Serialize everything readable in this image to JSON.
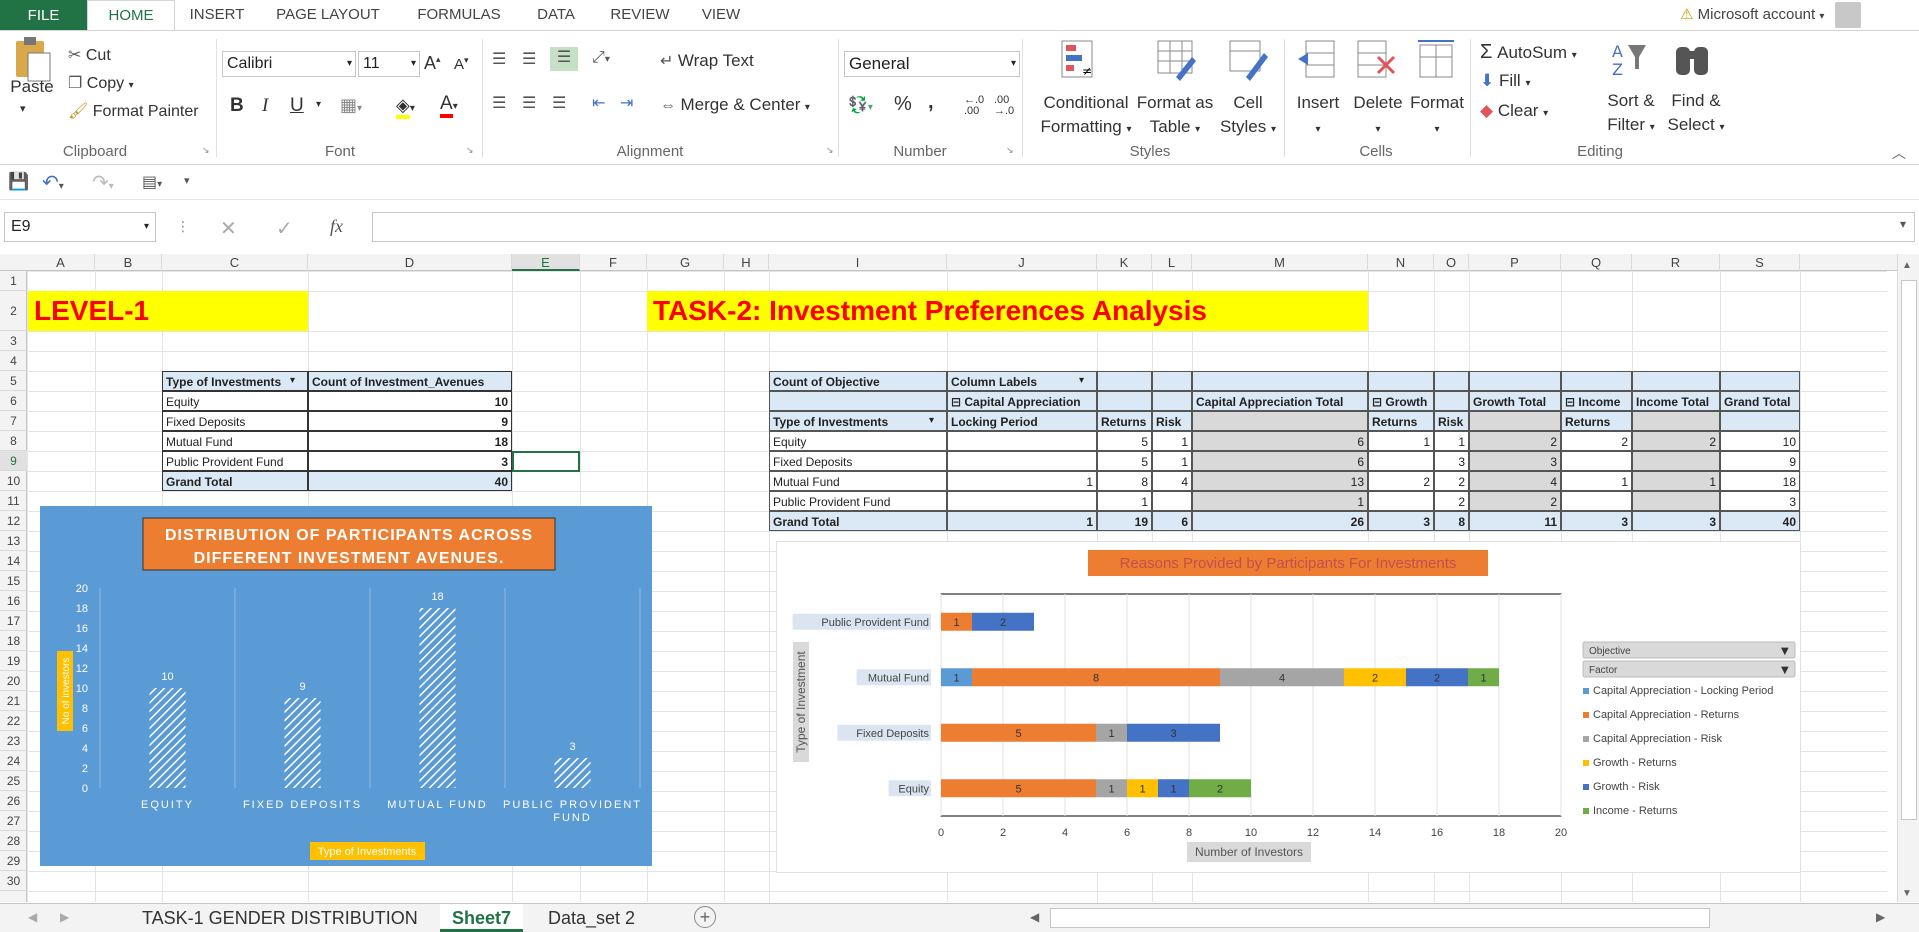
{
  "ribbon": {
    "file": "FILE",
    "tabs": [
      "HOME",
      "INSERT",
      "PAGE LAYOUT",
      "FORMULAS",
      "DATA",
      "REVIEW",
      "VIEW"
    ],
    "account": "Microsoft account",
    "clipboard": {
      "paste": "Paste",
      "cut": "Cut",
      "copy": "Copy",
      "format_painter": "Format Painter",
      "label": "Clipboard"
    },
    "font": {
      "name": "Calibri",
      "size": "11",
      "bold": "B",
      "italic": "I",
      "underline": "U",
      "label": "Font"
    },
    "alignment": {
      "wrap": "Wrap Text",
      "merge": "Merge & Center",
      "label": "Alignment"
    },
    "number": {
      "format": "General",
      "percent": "%",
      "comma": ",",
      "label": "Number"
    },
    "styles": {
      "conditional": [
        "Conditional",
        "Formatting"
      ],
      "format_table": [
        "Format as",
        "Table"
      ],
      "cell_styles": [
        "Cell",
        "Styles"
      ],
      "label": "Styles"
    },
    "cells": {
      "insert": "Insert",
      "delete": "Delete",
      "format": "Format",
      "label": "Cells"
    },
    "editing": {
      "autosum": "AutoSum",
      "fill": "Fill",
      "clear": "Clear",
      "sort": [
        "Sort &",
        "Filter"
      ],
      "find": [
        "Find &",
        "Select"
      ],
      "label": "Editing"
    }
  },
  "formula_bar": {
    "name_box": "E9",
    "fx": "fx",
    "value": ""
  },
  "columns": [
    "A",
    "B",
    "C",
    "D",
    "E",
    "F",
    "G",
    "H",
    "I",
    "J",
    "K",
    "L",
    "M",
    "N",
    "O",
    "P",
    "Q",
    "R",
    "S"
  ],
  "rows": [
    "1",
    "2",
    "3",
    "4",
    "5",
    "6",
    "7",
    "8",
    "9",
    "10",
    "11",
    "12",
    "13",
    "14",
    "15",
    "16",
    "17",
    "18",
    "19",
    "20",
    "21",
    "22",
    "23",
    "24",
    "25",
    "26",
    "27",
    "28",
    "29",
    "30"
  ],
  "titles": {
    "level": "LEVEL-1",
    "task": "TASK-2: Investment Preferences Analysis"
  },
  "pivot1": {
    "h1": "Type of Investments",
    "h2": "Count of Investment_Avenues",
    "rows": [
      {
        "name": "Equity",
        "value": "10"
      },
      {
        "name": "Fixed Deposits",
        "value": "9"
      },
      {
        "name": "Mutual Fund",
        "value": "18"
      },
      {
        "name": "Public Provident Fund",
        "value": "3"
      }
    ],
    "total_label": "Grand Total",
    "total": "40"
  },
  "pivot2": {
    "corner": "Count of Objective",
    "col_labels": "Column Labels",
    "cap_app": "Capital Appreciation",
    "cap_total": "Capital Appreciation Total",
    "growth": "Growth",
    "growth_total": "Growth Total",
    "income": "Income",
    "income_total": "Income Total",
    "grand_total": "Grand Total",
    "type_label": "Type of Investments",
    "locking": "Locking Period",
    "returns": "Returns",
    "risk": "Risk",
    "rows": [
      {
        "name": "Equity",
        "lp": "",
        "ret": "5",
        "risk": "1",
        "cat": "6",
        "gret": "1",
        "grisk": "1",
        "gt": "2",
        "iret": "2",
        "it": "2",
        "total": "10"
      },
      {
        "name": "Fixed Deposits",
        "lp": "",
        "ret": "5",
        "risk": "1",
        "cat": "6",
        "gret": "",
        "grisk": "3",
        "gt": "3",
        "iret": "",
        "it": "",
        "total": "9"
      },
      {
        "name": "Mutual Fund",
        "lp": "1",
        "ret": "8",
        "risk": "4",
        "cat": "13",
        "gret": "2",
        "grisk": "2",
        "gt": "4",
        "iret": "1",
        "it": "1",
        "total": "18"
      },
      {
        "name": "Public Provident Fund",
        "lp": "",
        "ret": "1",
        "risk": "",
        "cat": "1",
        "gret": "",
        "grisk": "2",
        "gt": "2",
        "iret": "",
        "it": "",
        "total": "3"
      }
    ],
    "total_row": {
      "name": "Grand Total",
      "lp": "1",
      "ret": "19",
      "risk": "6",
      "cat": "26",
      "gret": "3",
      "grisk": "8",
      "gt": "11",
      "iret": "3",
      "it": "3",
      "total": "40"
    }
  },
  "chart_data": [
    {
      "type": "bar",
      "title": "DISTRIBUTION OF PARTICIPANTS ACROSS DIFFERENT INVESTMENT AVENUES.",
      "categories": [
        "EQUITY",
        "FIXED DEPOSITS",
        "MUTUAL FUND",
        "PUBLIC PROVIDENT FUND"
      ],
      "values": [
        10,
        9,
        18,
        3
      ],
      "xlabel": "Type of Investments",
      "ylabel": "No of investors",
      "ylim": [
        0,
        20
      ],
      "yticks": [
        0,
        2,
        4,
        6,
        8,
        10,
        12,
        14,
        16,
        18,
        20
      ],
      "colors": {
        "background": "#5b9bd5",
        "title_bg": "#ed7d31",
        "label_bg": "#ffc000"
      }
    },
    {
      "type": "bar",
      "orientation": "horizontal-stacked",
      "title": "Reasons Provided by Participants For Investments",
      "categories": [
        "Equity",
        "Fixed Deposits",
        "Mutual Fund",
        "Public Provident Fund"
      ],
      "series": [
        {
          "name": "Capital Appreciation - Locking Period",
          "color": "#5b9bd5",
          "values": [
            0,
            0,
            1,
            0
          ]
        },
        {
          "name": "Capital Appreciation - Returns",
          "color": "#ed7d31",
          "values": [
            5,
            5,
            8,
            1
          ]
        },
        {
          "name": "Capital Appreciation - Risk",
          "color": "#a5a5a5",
          "values": [
            1,
            1,
            4,
            0
          ]
        },
        {
          "name": "Growth - Returns",
          "color": "#ffc000",
          "values": [
            1,
            0,
            2,
            0
          ]
        },
        {
          "name": "Growth - Risk",
          "color": "#4472c4",
          "values": [
            1,
            3,
            2,
            2
          ]
        },
        {
          "name": "Income - Returns",
          "color": "#70ad47",
          "values": [
            2,
            0,
            1,
            0
          ]
        }
      ],
      "xlabel": "Number of Investors",
      "ylabel": "Type of Investment",
      "xlim": [
        0,
        20
      ],
      "xticks": [
        0,
        2,
        4,
        6,
        8,
        10,
        12,
        14,
        16,
        18,
        20
      ],
      "legend_filters": [
        "Objective",
        "Factor"
      ],
      "legend_position": "right"
    }
  ],
  "sheets": [
    "TASK-1 GENDER DISTRIBUTION",
    "Sheet7",
    "Data_set 2"
  ],
  "active_sheet": "Sheet7"
}
